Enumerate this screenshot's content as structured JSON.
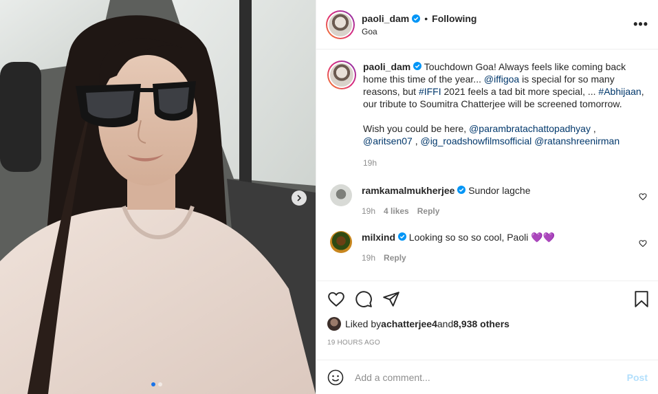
{
  "header": {
    "username": "paoli_dam",
    "separator": "•",
    "follow_status": "Following",
    "location": "Goa",
    "more_label": "•••"
  },
  "caption": {
    "username": "paoli_dam",
    "text_1": "Touchdown Goa! Always feels like coming back home this time of the year... ",
    "mention_iffigoa": "@iffigoa",
    "text_2": " is special for so many reasons, but ",
    "tag_iffi": "#IFFI",
    "text_3": " 2021 feels a tad bit more special, ... ",
    "tag_abhijaan": "#Abhijaan",
    "text_4": ", our tribute to Soumitra Chatterjee will be screened tomorrow.",
    "text_5": "Wish you could be here, ",
    "mention_1": "@parambratachattopadhyay",
    "comma_1": " , ",
    "mention_2": "@aritsen07",
    "comma_2": " , ",
    "mention_3": "@ig_roadshowfilmsofficial",
    "space": " ",
    "mention_4": "@ratanshreenirman",
    "time": "19h"
  },
  "comments": [
    {
      "username": "ramkamalmukherjee",
      "text": "Sundor lagche",
      "time": "19h",
      "likes": "4 likes",
      "reply": "Reply"
    },
    {
      "username": "milxind",
      "text": "Looking so so so cool, Paoli 💜💜",
      "time": "19h",
      "reply": "Reply"
    }
  ],
  "likes": {
    "prefix": "Liked by ",
    "liker": "achatterjee4",
    "middle": " and ",
    "count": "8,938 others"
  },
  "time_ago": "19 HOURS AGO",
  "add_comment": {
    "placeholder": "Add a comment...",
    "post_label": "Post"
  },
  "carousel": {
    "slides": 2,
    "active": 1
  },
  "colors": {
    "link": "#00376b",
    "verified": "#0095f6",
    "muted": "#8e8e8e",
    "post_disabled": "#b2dffc",
    "dot_active": "#1a73e8"
  },
  "icons": [
    "verified-icon",
    "more-icon",
    "heart-icon",
    "comment-icon",
    "share-icon",
    "bookmark-icon",
    "emoji-icon",
    "chevron-right-icon"
  ]
}
